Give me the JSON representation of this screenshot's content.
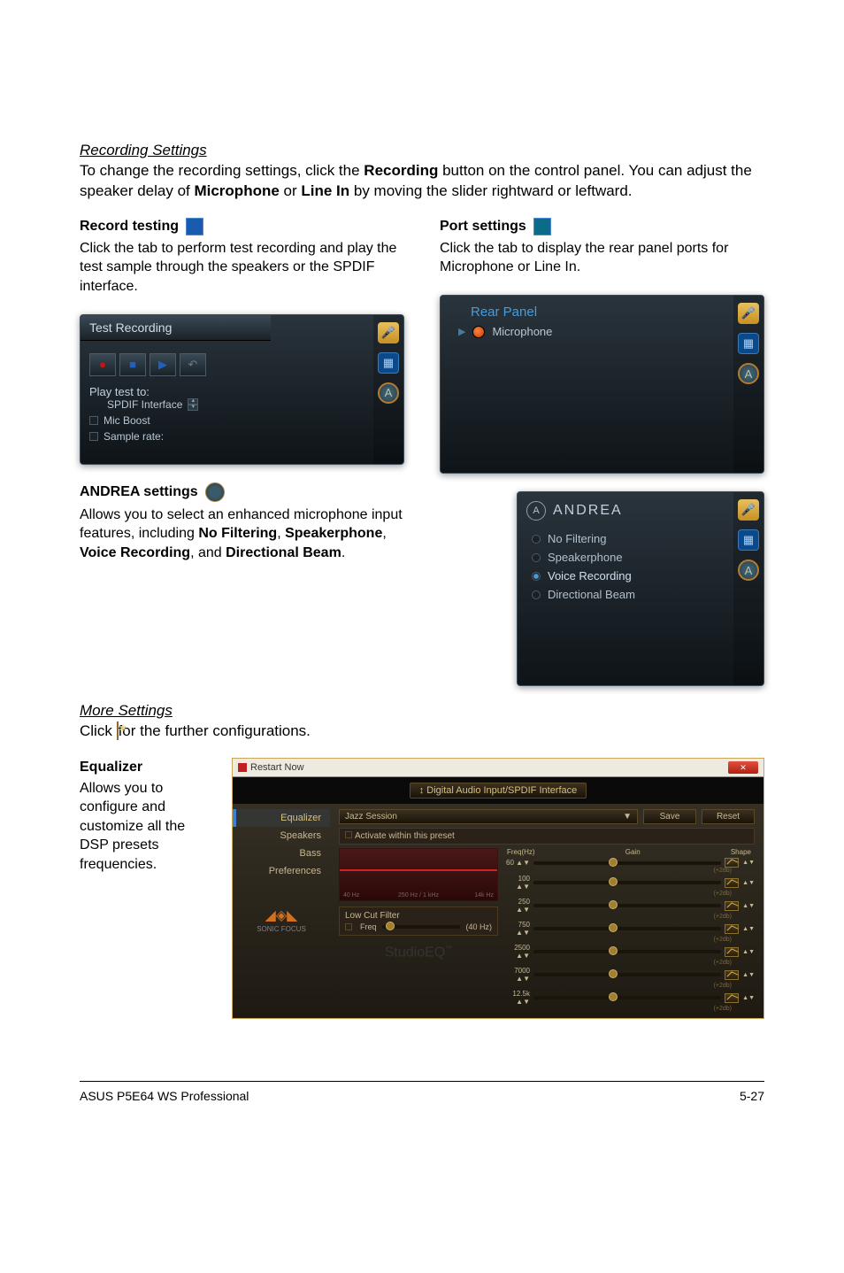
{
  "sections": {
    "recording_title": "Recording Settings",
    "recording_body": "To change the recording settings, click the <b>Recording</b> button on the control panel. You can adjust the speaker delay of <b>Microphone</b> or <b>Line In</b> by moving the slider rightward or leftward."
  },
  "record_testing": {
    "title": "Record testing",
    "body": "Click the tab to perform test recording and play the test sample through the speakers or the SPDIF interface.",
    "panel": {
      "tab": "Test Recording",
      "play_to": "Play test to:",
      "spdif": "SPDIF Interface",
      "mic_boost": "Mic Boost",
      "sample_rate": "Sample rate:"
    }
  },
  "port_settings": {
    "title": "Port settings",
    "body": "Click the tab to display the rear panel ports for Microphone or Line In.",
    "panel": {
      "rear": "Rear Panel",
      "mic": "Microphone"
    }
  },
  "andrea": {
    "title": "ANDREA settings",
    "body": "Allows you to select an enhanced microphone input features, including <b>No Filtering</b>, <b>Speakerphone</b>, <b>Voice Recording</b>, and <b>Directional Beam</b>.",
    "panel": {
      "brand": "ANDREA",
      "items": [
        "No Filtering",
        "Speakerphone",
        "Voice Recording",
        "Directional Beam"
      ]
    }
  },
  "more": {
    "title": "More Settings",
    "body_before": "Click ",
    "body_after": " for the further configurations."
  },
  "equalizer": {
    "title": "Equalizer",
    "body": "Allows you to configure and customize all the DSP presets frequencies.",
    "window": {
      "titlebar": "Restart Now",
      "tab": "Digital Audio Input/SPDIF Interface",
      "sidebar": [
        "Equalizer",
        "Speakers",
        "Bass",
        "Preferences"
      ],
      "sidebar_logo": "SONIC FOCUS",
      "preset": "Jazz Session",
      "save": "Save",
      "reset": "Reset",
      "activate": "Activate within this preset",
      "headers": [
        "Freq(Hz)",
        "Gain",
        "Shape"
      ],
      "freqs": [
        "60",
        "100",
        "250",
        "750",
        "2500",
        "7000",
        "12.5k"
      ],
      "db_unit": "(+2db)",
      "graph_left": "40 Hz",
      "graph_mid": "250 Hz / 1 kHz",
      "graph_right": "14k Hz",
      "lcf": "Low Cut Filter",
      "lcf_freq": "Freq",
      "lcf_val": "(40 Hz)",
      "studio": "StudioEQ",
      "studio_tm": "™"
    }
  },
  "footer": {
    "left": "ASUS P5E64 WS Professional",
    "right": "5-27"
  }
}
